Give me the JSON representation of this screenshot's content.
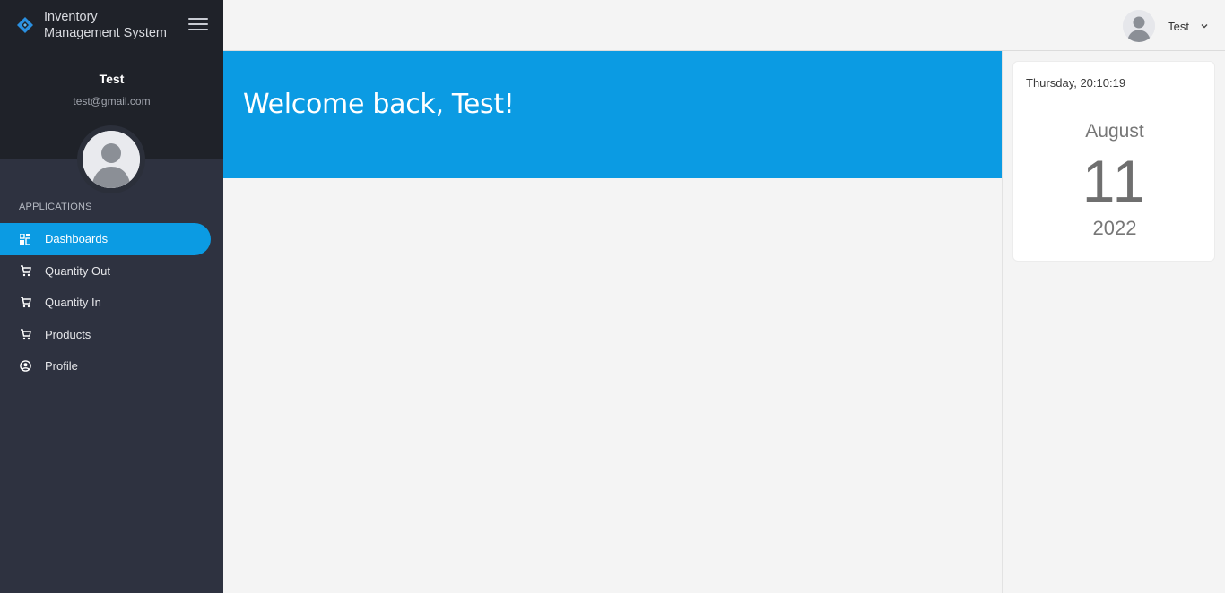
{
  "app": {
    "brand_line1": "Inventory",
    "brand_line2": "Management System",
    "brand_icon": "diamond-logo-icon",
    "accent_color": "#0b9be3"
  },
  "sidebar": {
    "user_name": "Test",
    "user_email": "test@gmail.com",
    "section_label": "APPLICATIONS",
    "items": [
      {
        "label": "Dashboards",
        "icon": "dashboard-icon",
        "active": true
      },
      {
        "label": "Quantity Out",
        "icon": "cart-icon",
        "active": false
      },
      {
        "label": "Quantity In",
        "icon": "cart-icon",
        "active": false
      },
      {
        "label": "Products",
        "icon": "cart-icon",
        "active": false
      },
      {
        "label": "Profile",
        "icon": "user-circle-icon",
        "active": false
      }
    ]
  },
  "topbar": {
    "user_name": "Test",
    "dropdown_icon": "chevron-down-icon"
  },
  "hero": {
    "title": "Welcome back, Test!"
  },
  "date_card": {
    "day_time": "Thursday, 20:10:19",
    "month": "August",
    "day": "11",
    "year": "2022"
  }
}
